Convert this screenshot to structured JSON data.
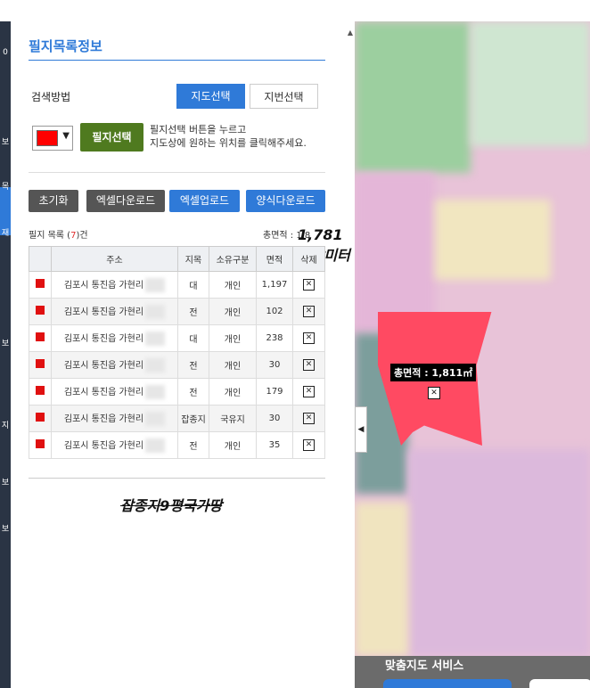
{
  "sidebar_tabs": [
    "0",
    "보",
    "목",
    "재",
    "보",
    "지",
    "보",
    "보"
  ],
  "panel": {
    "title": "필지목록정보",
    "search_label": "검색방법",
    "search_options": [
      "지도선택",
      "지번선택"
    ],
    "selected_search": "지도선택",
    "color_value": "#ff0000",
    "pick_button": "필지선택",
    "hint_lines": [
      "필지선택 버튼을 누르고",
      "지도상에 원하는 위치를 클릭해주세요."
    ],
    "buttons": [
      "초기화",
      "엑셀다운로드",
      "엑셀업로드",
      "양식다운로드"
    ],
    "count_prefix": "필지 목록 (",
    "count_value": "7",
    "count_suffix": ")건",
    "total_label": "총면적 : 1,8",
    "handwritten_total": "1,781평방미터",
    "handwritten_note": "잡종지9평국가땅"
  },
  "table": {
    "headers": [
      "",
      "주소",
      "지목",
      "소유구분",
      "면적",
      "삭제"
    ],
    "rows": [
      {
        "addr": "김포시 통진읍 가현리",
        "jimok": "대",
        "owner": "개인",
        "area": "1,197"
      },
      {
        "addr": "김포시 통진읍 가현리",
        "jimok": "전",
        "owner": "개인",
        "area": "102"
      },
      {
        "addr": "김포시 통진읍 가현리",
        "jimok": "대",
        "owner": "개인",
        "area": "238"
      },
      {
        "addr": "김포시 통진읍 가현리",
        "jimok": "전",
        "owner": "개인",
        "area": "30"
      },
      {
        "addr": "김포시 통진읍 가현리",
        "jimok": "전",
        "owner": "개인",
        "area": "179"
      },
      {
        "addr": "김포시 통진읍 가현리",
        "jimok": "잡종지",
        "owner": "국유지",
        "area": "30"
      },
      {
        "addr": "김포시 통진읍 가현리",
        "jimok": "전",
        "owner": "개인",
        "area": "35"
      }
    ]
  },
  "map": {
    "area_label": "총면적 : 1,811㎡",
    "service_label": "맞춤지도 서비스",
    "collapse_icon": "chevron-left-icon"
  }
}
